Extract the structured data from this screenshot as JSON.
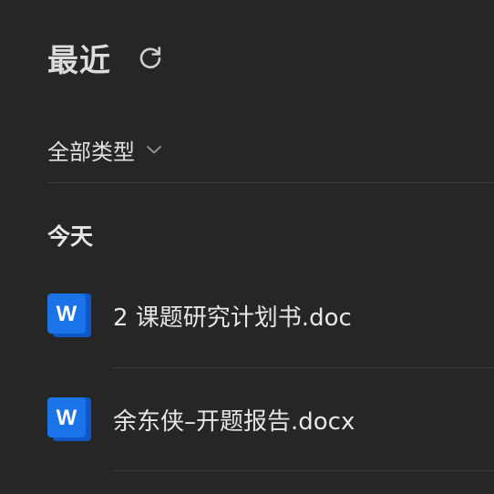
{
  "header": {
    "title": "最近",
    "refresh_icon": "refresh-icon"
  },
  "filter": {
    "label": "全部类型",
    "chevron_icon": "chevron-down-icon"
  },
  "section": {
    "label": "今天"
  },
  "files": [
    {
      "name": "2 课题研究计划书.doc",
      "icon": "word-doc-icon",
      "icon_letter": "W"
    },
    {
      "name": "余东侠–开题报告.docx",
      "icon": "word-doc-icon",
      "icon_letter": "W"
    }
  ],
  "colors": {
    "background": "#262626",
    "word_blue": "#1a73e8",
    "word_blue_dark": "#0f56c6",
    "divider": "#3d3d3d",
    "text": "#e6e6e6"
  }
}
